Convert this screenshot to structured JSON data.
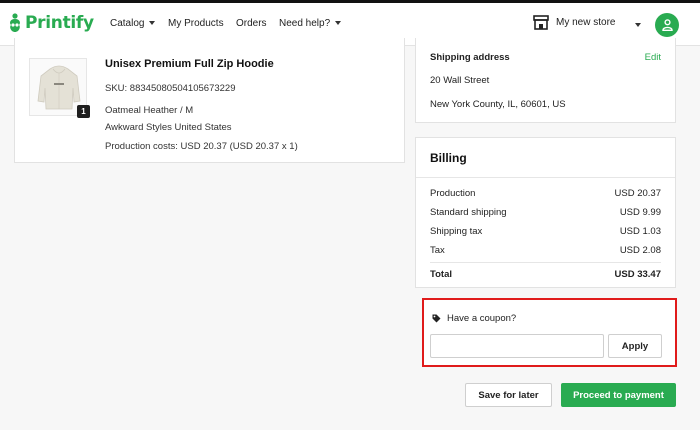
{
  "brand": {
    "name": "Printify",
    "accent_color": "#29ab51",
    "logo_icon": "printify-logo-icon"
  },
  "nav": {
    "catalog": "Catalog",
    "my_products": "My Products",
    "orders": "Orders",
    "need_help": "Need help?",
    "store_name": "My new store",
    "store_icon": "storefront-icon",
    "avatar_icon": "user-icon"
  },
  "product": {
    "title": "Unisex Premium Full Zip Hoodie",
    "sku": "SKU: 88345080504105673229",
    "variant": "Oatmeal Heather / M",
    "provider": "Awkward Styles United States",
    "production_costs": "Production costs: USD 20.37 (USD 20.37 x 1)",
    "quantity": "1",
    "image_icon": "hoodie-image"
  },
  "shipping": {
    "heading": "Shipping address",
    "edit_label": "Edit",
    "street": "20 Wall Street",
    "city_line": "New York County, IL, 60601, US"
  },
  "billing": {
    "heading": "Billing",
    "rows": [
      {
        "label": "Production",
        "value": "USD 20.37"
      },
      {
        "label": "Standard shipping",
        "value": "USD 9.99"
      },
      {
        "label": "Shipping tax",
        "value": "USD 1.03"
      },
      {
        "label": "Tax",
        "value": "USD 2.08"
      }
    ],
    "total_label": "Total",
    "total_value": "USD 33.47"
  },
  "coupon": {
    "label": "Have a coupon?",
    "icon": "tag-icon",
    "input_value": "",
    "input_placeholder": "",
    "apply_label": "Apply",
    "highlight_color": "#e01b1b"
  },
  "actions": {
    "save_label": "Save for later",
    "pay_label": "Proceed to payment"
  }
}
